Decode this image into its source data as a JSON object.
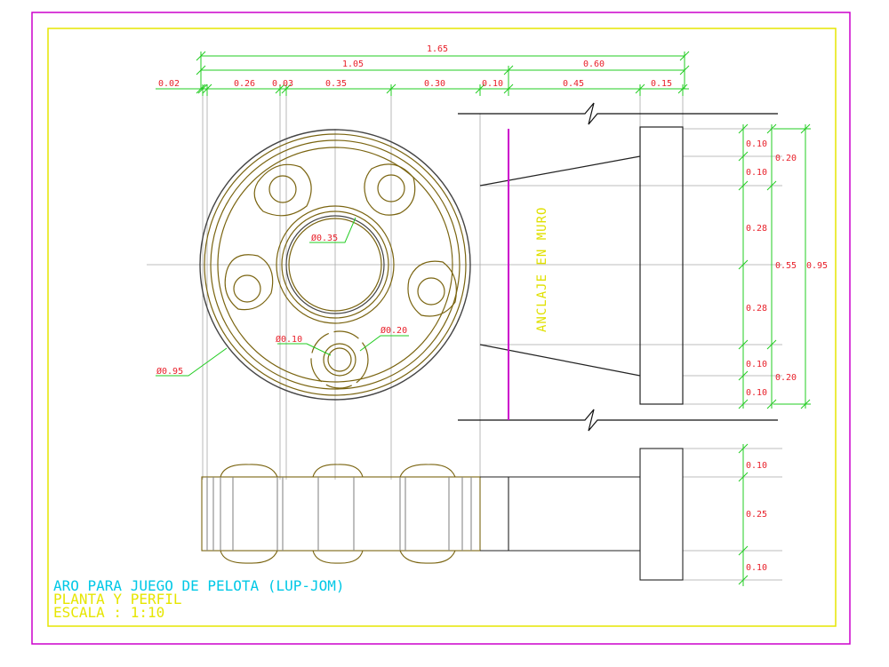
{
  "colors": {
    "outer_border": "#cc00cc",
    "inner_border": "#e6e600",
    "object": "#7a6410",
    "dimension_line": "#22cc22",
    "dimension_text": "#e8202a",
    "construction": "#a8a8a8",
    "section": "#111111",
    "anchor_axis": "#cc00cc",
    "title_line1": "#00c8e6",
    "title_lines": "#e6e600"
  },
  "top_dimensions": {
    "total": "1.65",
    "row2": [
      "1.05",
      "0.60"
    ],
    "row3": [
      "0.02",
      "0.26",
      "0.03",
      "0.35",
      "0.30",
      "0.10",
      "0.45",
      "0.15"
    ]
  },
  "side_dimensions": {
    "inner": [
      "0.10",
      "0.10",
      "0.28",
      "0.28",
      "0.10",
      "0.10"
    ],
    "middle": [
      "0.20",
      "0.55",
      "0.20"
    ],
    "outer": "0.95"
  },
  "profile_dimensions": [
    "0.10",
    "0.25",
    "0.10"
  ],
  "diameters": {
    "center_hole": "Ø0.35",
    "small_hole": "Ø0.10",
    "boss": "Ø0.20",
    "outer": "Ø0.95"
  },
  "anchor_label": "ANCLAJE EN MURO",
  "title_block": {
    "line1": "ARO PARA JUEGO DE PELOTA (LUP-JOM)",
    "line2": "PLANTA Y PERFIL",
    "line3": "ESCALA : 1:10"
  }
}
